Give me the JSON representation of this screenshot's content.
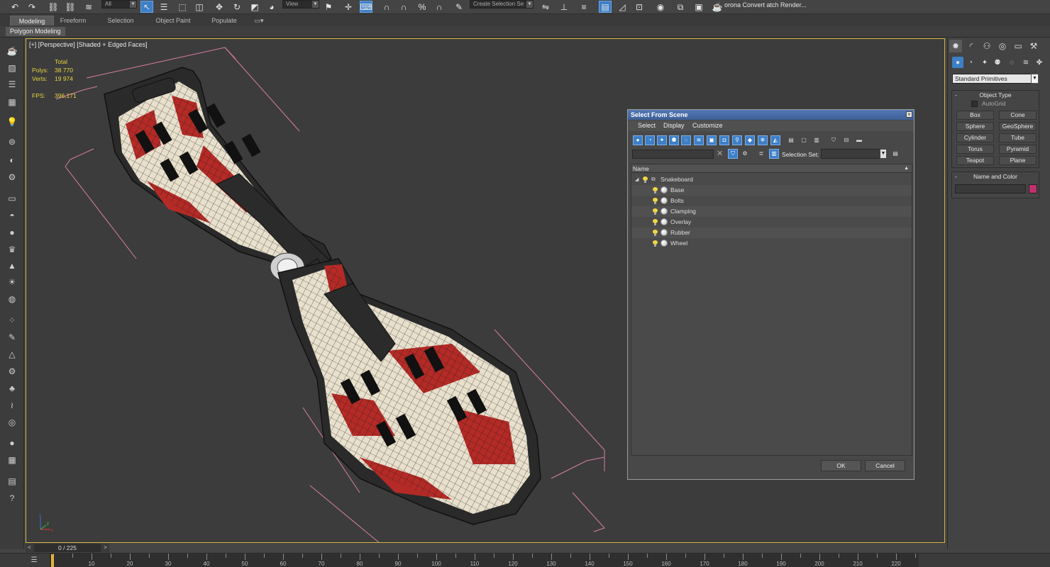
{
  "toolbar": {
    "selection_filter": "All",
    "view_dropdown": "View",
    "create_selection_set": "Create Selection Se",
    "render_text": "orona Convert atch Render..."
  },
  "ribbon": {
    "tabs": [
      "Modeling",
      "Freeform",
      "Selection",
      "Object Paint",
      "Populate"
    ],
    "active_tab": "Modeling",
    "sub_label": "Polygon Modeling"
  },
  "viewport": {
    "label": "[+] [Perspective] [Shaded + Edged Faces]",
    "stats": {
      "total_label": "Total",
      "polys_label": "Polys:",
      "polys_value": "38 770",
      "verts_label": "Verts:",
      "verts_value": "19 974",
      "fps_label": "FPS:",
      "fps_value": "396,171"
    },
    "axis": {
      "x": "x",
      "y": "y",
      "z": "z"
    }
  },
  "command_panel": {
    "dropdown": "Standard Primitives",
    "object_type": {
      "title": "Object Type",
      "autogrid": "AutoGrid",
      "buttons": [
        "Box",
        "Cone",
        "Sphere",
        "GeoSphere",
        "Cylinder",
        "Tube",
        "Torus",
        "Pyramid",
        "Teapot",
        "Plane"
      ]
    },
    "name_and_color": {
      "title": "Name and Color",
      "color": "#c0306f"
    }
  },
  "dialog": {
    "title": "Select From Scene",
    "menu": [
      "Select",
      "Display",
      "Customize"
    ],
    "selection_set_label": "Selection Set:",
    "column_name": "Name",
    "tree": {
      "root": "Snakeboard",
      "children": [
        "Base",
        "Bolts",
        "Clamping",
        "Overlay",
        "Rubber",
        "Wheel"
      ]
    },
    "ok": "OK",
    "cancel": "Cancel"
  },
  "timeline": {
    "frame_display": "0 / 225",
    "ticks": [
      "10",
      "20",
      "30",
      "40",
      "50",
      "60",
      "70",
      "80",
      "90",
      "100",
      "110",
      "120",
      "130",
      "140",
      "150",
      "160",
      "170",
      "180",
      "190",
      "200",
      "210",
      "220"
    ]
  },
  "colors": {
    "accent_blue": "#3d7fc8",
    "viewport_border": "#d6b340",
    "stats_yellow": "#e8d440",
    "board_red": "#b42a26",
    "board_cream": "#e8e0cc"
  }
}
